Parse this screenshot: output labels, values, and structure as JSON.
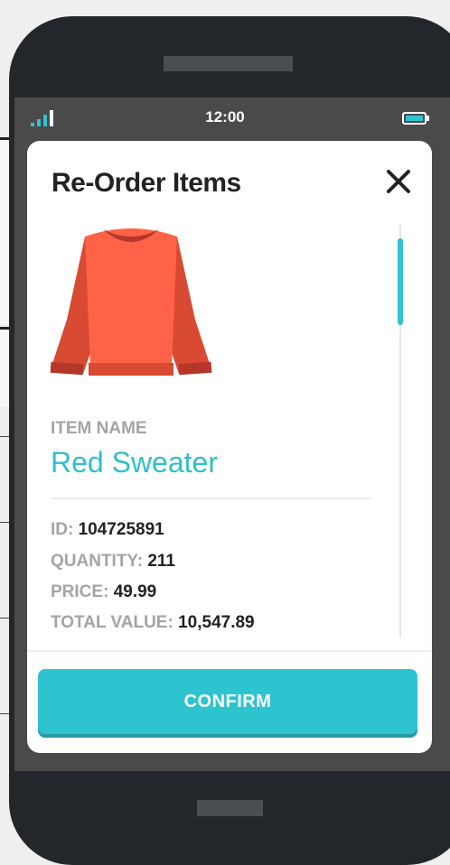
{
  "status_bar": {
    "time": "12:00"
  },
  "modal": {
    "title": "Re-Order Items",
    "item_name_label": "ITEM NAME",
    "item_name": "Red Sweater",
    "details": [
      {
        "label": "ID:",
        "value": "104725891"
      },
      {
        "label": "QUANTITY:",
        "value": "211"
      },
      {
        "label": "PRICE:",
        "value": "49.99"
      },
      {
        "label": "TOTAL VALUE:",
        "value": "10,547.89"
      }
    ],
    "confirm_label": "CONFIRM"
  },
  "colors": {
    "accent": "#2ec4cf",
    "sweater": "#ff6347",
    "phone": "#23272b"
  }
}
